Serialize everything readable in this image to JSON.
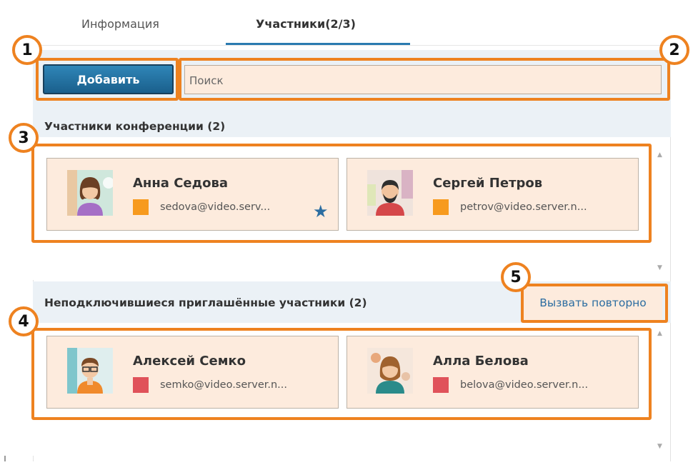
{
  "tabs": {
    "info_label": "Информация",
    "members_label": "Участники(2/3)"
  },
  "toolbar": {
    "add_label": "Добавить",
    "search_placeholder": "Поиск"
  },
  "conference": {
    "title": "Участники конференции (2)",
    "participants": [
      {
        "name": "Анна Седова",
        "email": "sedova@video.serv...",
        "status_color": "#f79a1e",
        "starred": true
      },
      {
        "name": "Сергей Петров",
        "email": "petrov@video.server.n...",
        "status_color": "#f79a1e",
        "starred": false
      }
    ]
  },
  "invited": {
    "title": "Неподключившиеся приглашённые участники (2)",
    "recall_label": "Вызвать повторно",
    "participants": [
      {
        "name": "Алексей Семко",
        "email": "semko@video.server.n...",
        "status_color": "#e0525a"
      },
      {
        "name": "Алла Белова",
        "email": "belova@video.server.n...",
        "status_color": "#e0525a"
      }
    ]
  },
  "annotations": [
    "1",
    "2",
    "3",
    "4",
    "5"
  ],
  "icons": {
    "star": "★",
    "scroll_up": "▲",
    "scroll_down": "▼"
  },
  "colors": {
    "accent": "#2c6da1",
    "highlight": "#ee8220",
    "card_bg": "#fdebdd"
  }
}
